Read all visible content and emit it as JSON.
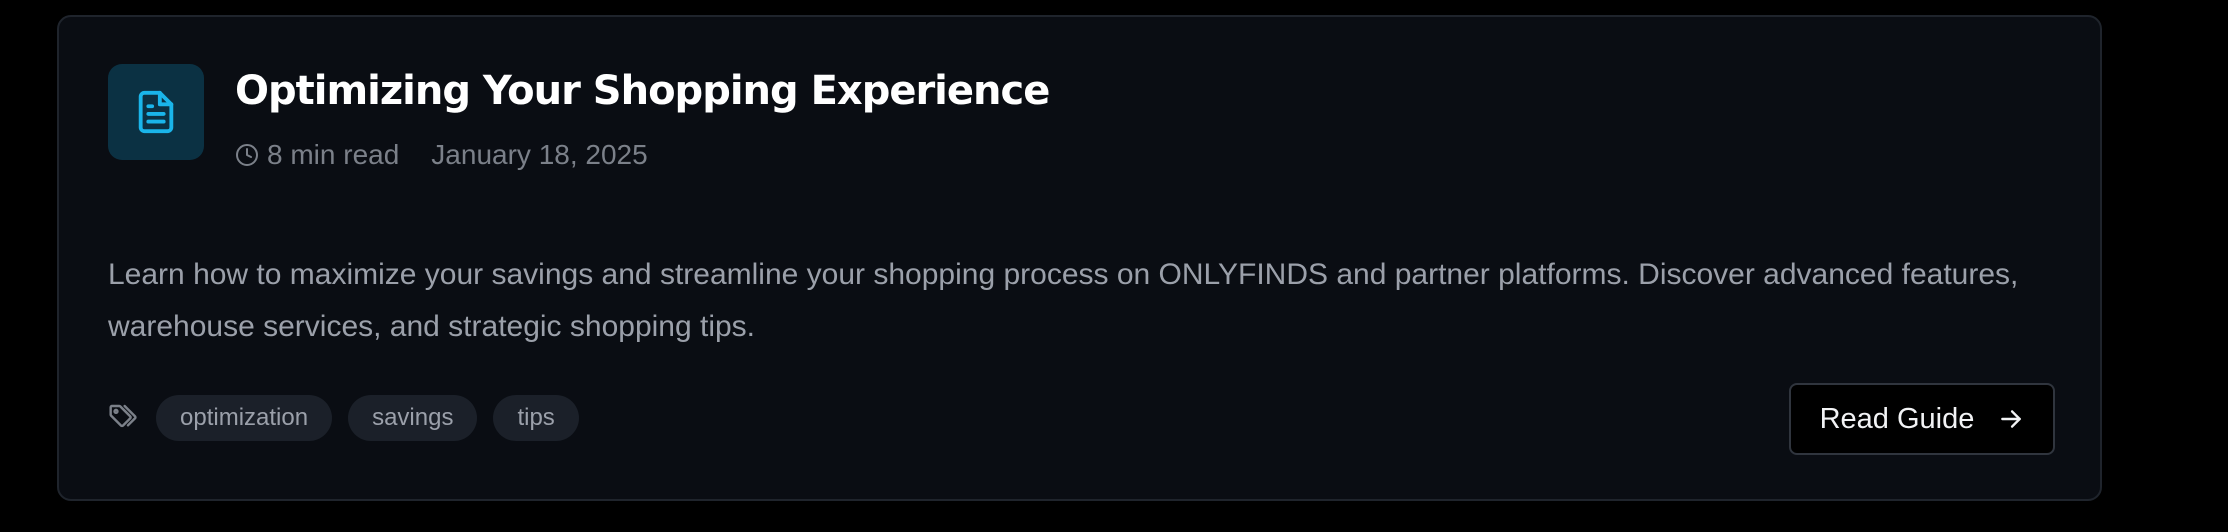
{
  "card": {
    "title": "Optimizing Your Shopping Experience",
    "icon": "document-icon",
    "meta": {
      "read_time": "8 min read",
      "read_time_icon": "clock-icon",
      "date": "January 18, 2025"
    },
    "description": "Learn how to maximize your savings and streamline your shopping process on ONLYFINDS and partner platforms. Discover advanced features, warehouse services, and strategic shopping tips.",
    "tags_icon": "tags-icon",
    "tags": [
      "optimization",
      "savings",
      "tips"
    ],
    "cta": {
      "label": "Read Guide",
      "icon": "arrow-right-icon"
    }
  },
  "colors": {
    "page_background": "#000000",
    "card_background": "#0a0d13",
    "card_border": "#1f242c",
    "accent": "#1ab5ea",
    "icon_background": "#0b3143",
    "title_text": "#ffffff",
    "muted_text": "#7b8089",
    "body_text": "#9ba0aa",
    "tag_background": "#1b2029"
  }
}
